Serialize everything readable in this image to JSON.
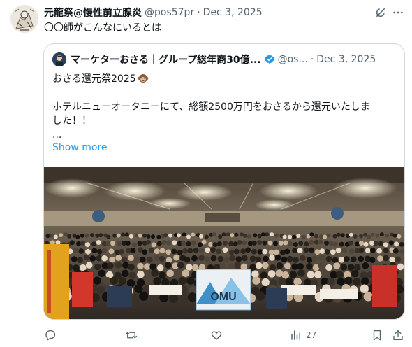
{
  "post": {
    "author_name": "元龍祭@慢性前立腺炎",
    "author_handle": "@pos57pr",
    "separator": "·",
    "date": "Dec 3, 2025",
    "text": "〇〇師がこんなにいるとは"
  },
  "quote": {
    "author_name": "マーケターおさる｜グループ総年商30億...",
    "author_handle": "@os...",
    "separator": "·",
    "date": "Dec 3, 2025",
    "line1": "おさる還元祭2025",
    "line2": "",
    "line3": "ホテルニューオータニーにて、総額2500万円をおさるから還元いたしま",
    "line4": "した！！",
    "line5": "...",
    "show_more": "Show more",
    "banner_text": "OMU"
  },
  "actions": {
    "views_count": "27"
  },
  "icons": {
    "grok": "grok-icon",
    "more": "more-icon",
    "verified": "verified-badge-icon",
    "monkey": "monkey-emoji-icon",
    "reply": "reply-icon",
    "repost": "repost-icon",
    "like": "like-icon",
    "views": "views-icon",
    "bookmark": "bookmark-icon",
    "share": "share-icon"
  },
  "colors": {
    "text": "#0f1419",
    "secondary": "#536471",
    "link": "#1d9bf0",
    "verified": "#1d9bf0",
    "border": "#cfd9de"
  }
}
